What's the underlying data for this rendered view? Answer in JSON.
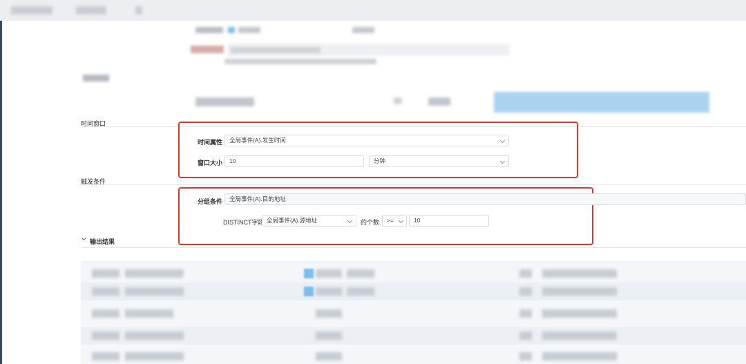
{
  "sections": {
    "time_window": "时间窗口",
    "trigger": "触发条件",
    "output": "输出结果"
  },
  "time_window": {
    "time_attr_label": "时间属性",
    "time_attr_value": "全局事件(A).发生时间",
    "window_size_label": "窗口大小",
    "window_size_value": "10",
    "window_unit": "分钟"
  },
  "trigger": {
    "group_label": "分组条件",
    "group_value": "全局事件(A).目的地址",
    "distinct_label": "DISTINCT字段",
    "distinct_value": "全局事件(A).源地址",
    "count_label": "的个数",
    "operator": ">=",
    "count_value": "10"
  },
  "colors": {
    "highlight_border": "#e4352d",
    "blurred_accent": "#7bbde8"
  }
}
